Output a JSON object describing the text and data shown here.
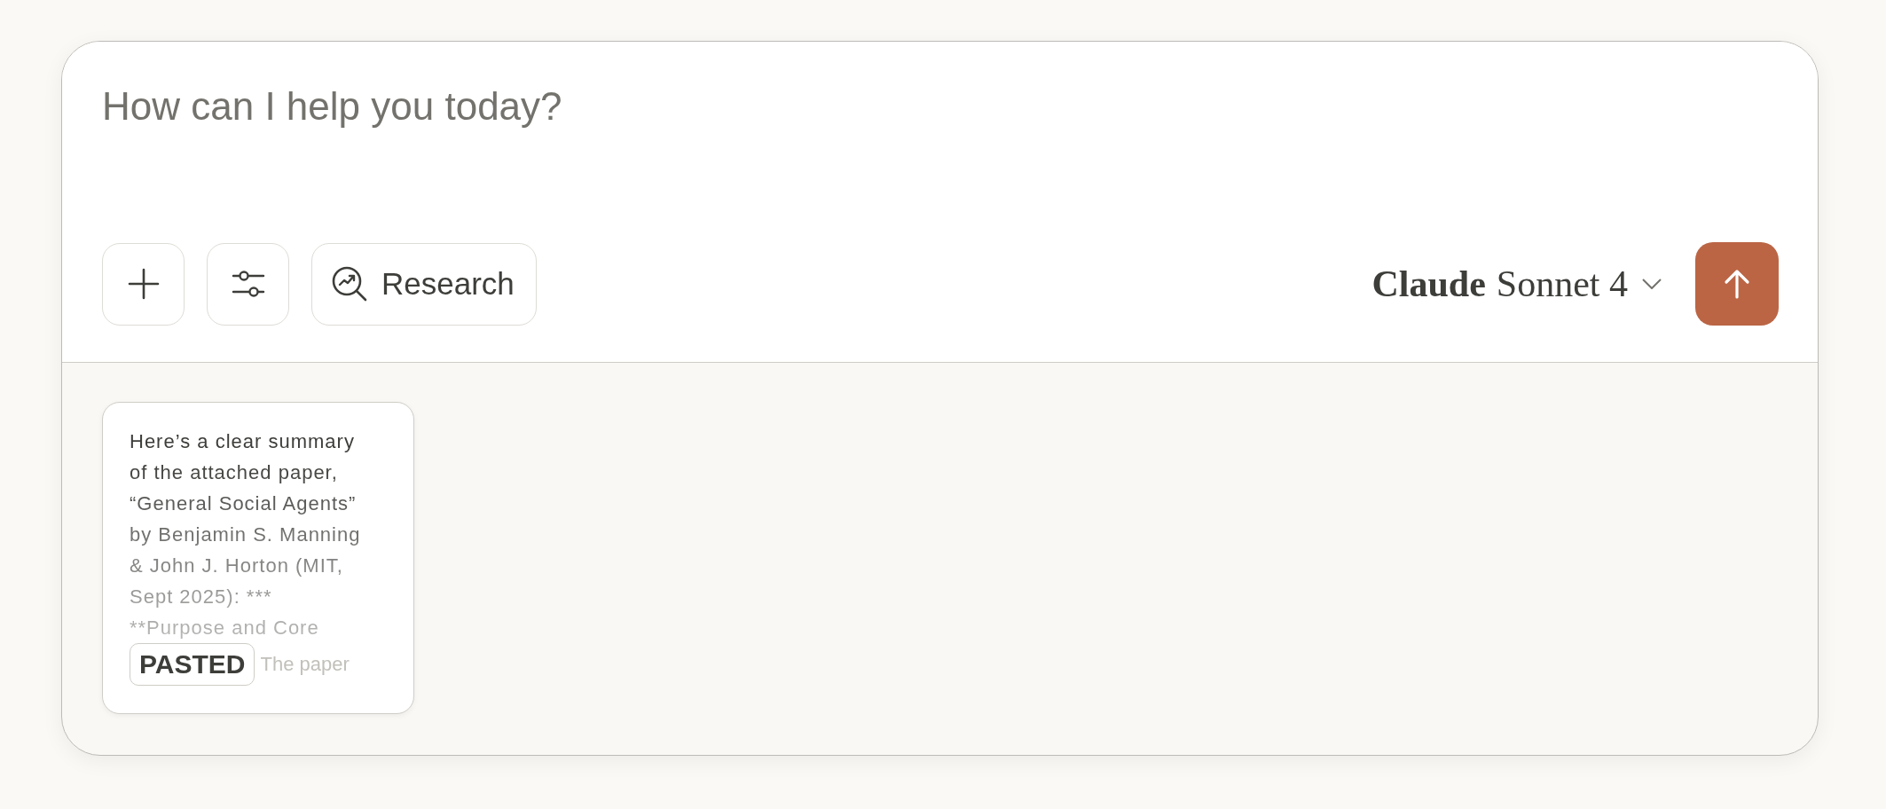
{
  "composer": {
    "placeholder": "How can I help you today?"
  },
  "toolbar": {
    "buttons": [
      {
        "kind": "add"
      },
      {
        "kind": "tools"
      },
      {
        "kind": "research",
        "label": "Research"
      }
    ]
  },
  "model_selector": {
    "brand": "Claude",
    "name": "Sonnet 4"
  },
  "attachments": [
    {
      "preview": "Here’s a clear summary of the attached paper, “General Social Agents” by Benjamin S. Manning & John J. Horton (MIT, Sept 2025): *** **Purpose and Core",
      "preview_tail": "The paper",
      "badge": "PASTED"
    }
  ]
}
